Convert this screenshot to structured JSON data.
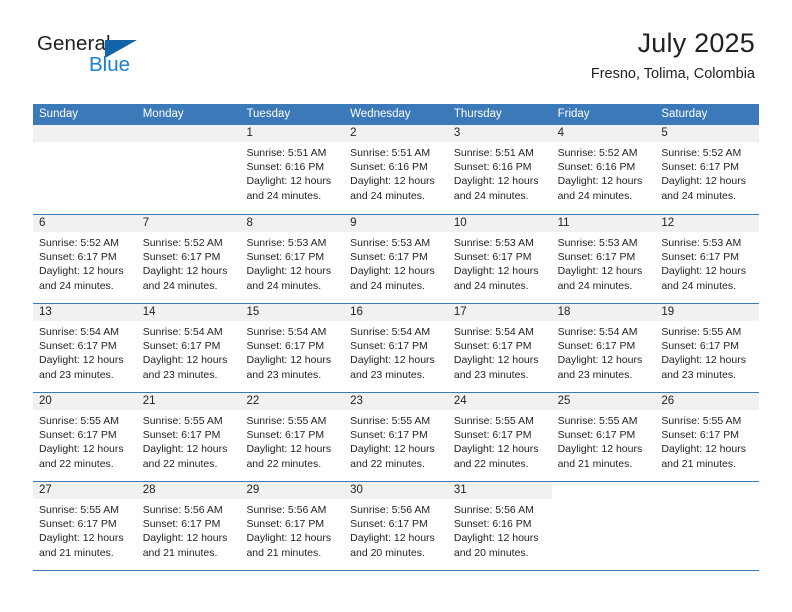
{
  "brand": {
    "name_part1": "General",
    "name_part2": "Blue",
    "logo_icon": "triangle-logo-icon"
  },
  "header": {
    "title": "July 2025",
    "location": "Fresno, Tolima, Colombia"
  },
  "calendar": {
    "weekday_headers": [
      "Sunday",
      "Monday",
      "Tuesday",
      "Wednesday",
      "Thursday",
      "Friday",
      "Saturday"
    ],
    "accent_color": "#3b79b8",
    "daynum_strip_color": "#f1f1f1",
    "weeks": [
      [
        {
          "day": "",
          "blank": true
        },
        {
          "day": "",
          "blank": true
        },
        {
          "day": "1",
          "sunrise": "Sunrise: 5:51 AM",
          "sunset": "Sunset: 6:16 PM",
          "daylight1": "Daylight: 12 hours",
          "daylight2": "and 24 minutes."
        },
        {
          "day": "2",
          "sunrise": "Sunrise: 5:51 AM",
          "sunset": "Sunset: 6:16 PM",
          "daylight1": "Daylight: 12 hours",
          "daylight2": "and 24 minutes."
        },
        {
          "day": "3",
          "sunrise": "Sunrise: 5:51 AM",
          "sunset": "Sunset: 6:16 PM",
          "daylight1": "Daylight: 12 hours",
          "daylight2": "and 24 minutes."
        },
        {
          "day": "4",
          "sunrise": "Sunrise: 5:52 AM",
          "sunset": "Sunset: 6:16 PM",
          "daylight1": "Daylight: 12 hours",
          "daylight2": "and 24 minutes."
        },
        {
          "day": "5",
          "sunrise": "Sunrise: 5:52 AM",
          "sunset": "Sunset: 6:17 PM",
          "daylight1": "Daylight: 12 hours",
          "daylight2": "and 24 minutes."
        }
      ],
      [
        {
          "day": "6",
          "sunrise": "Sunrise: 5:52 AM",
          "sunset": "Sunset: 6:17 PM",
          "daylight1": "Daylight: 12 hours",
          "daylight2": "and 24 minutes."
        },
        {
          "day": "7",
          "sunrise": "Sunrise: 5:52 AM",
          "sunset": "Sunset: 6:17 PM",
          "daylight1": "Daylight: 12 hours",
          "daylight2": "and 24 minutes."
        },
        {
          "day": "8",
          "sunrise": "Sunrise: 5:53 AM",
          "sunset": "Sunset: 6:17 PM",
          "daylight1": "Daylight: 12 hours",
          "daylight2": "and 24 minutes."
        },
        {
          "day": "9",
          "sunrise": "Sunrise: 5:53 AM",
          "sunset": "Sunset: 6:17 PM",
          "daylight1": "Daylight: 12 hours",
          "daylight2": "and 24 minutes."
        },
        {
          "day": "10",
          "sunrise": "Sunrise: 5:53 AM",
          "sunset": "Sunset: 6:17 PM",
          "daylight1": "Daylight: 12 hours",
          "daylight2": "and 24 minutes."
        },
        {
          "day": "11",
          "sunrise": "Sunrise: 5:53 AM",
          "sunset": "Sunset: 6:17 PM",
          "daylight1": "Daylight: 12 hours",
          "daylight2": "and 24 minutes."
        },
        {
          "day": "12",
          "sunrise": "Sunrise: 5:53 AM",
          "sunset": "Sunset: 6:17 PM",
          "daylight1": "Daylight: 12 hours",
          "daylight2": "and 24 minutes."
        }
      ],
      [
        {
          "day": "13",
          "sunrise": "Sunrise: 5:54 AM",
          "sunset": "Sunset: 6:17 PM",
          "daylight1": "Daylight: 12 hours",
          "daylight2": "and 23 minutes."
        },
        {
          "day": "14",
          "sunrise": "Sunrise: 5:54 AM",
          "sunset": "Sunset: 6:17 PM",
          "daylight1": "Daylight: 12 hours",
          "daylight2": "and 23 minutes."
        },
        {
          "day": "15",
          "sunrise": "Sunrise: 5:54 AM",
          "sunset": "Sunset: 6:17 PM",
          "daylight1": "Daylight: 12 hours",
          "daylight2": "and 23 minutes."
        },
        {
          "day": "16",
          "sunrise": "Sunrise: 5:54 AM",
          "sunset": "Sunset: 6:17 PM",
          "daylight1": "Daylight: 12 hours",
          "daylight2": "and 23 minutes."
        },
        {
          "day": "17",
          "sunrise": "Sunrise: 5:54 AM",
          "sunset": "Sunset: 6:17 PM",
          "daylight1": "Daylight: 12 hours",
          "daylight2": "and 23 minutes."
        },
        {
          "day": "18",
          "sunrise": "Sunrise: 5:54 AM",
          "sunset": "Sunset: 6:17 PM",
          "daylight1": "Daylight: 12 hours",
          "daylight2": "and 23 minutes."
        },
        {
          "day": "19",
          "sunrise": "Sunrise: 5:55 AM",
          "sunset": "Sunset: 6:17 PM",
          "daylight1": "Daylight: 12 hours",
          "daylight2": "and 23 minutes."
        }
      ],
      [
        {
          "day": "20",
          "sunrise": "Sunrise: 5:55 AM",
          "sunset": "Sunset: 6:17 PM",
          "daylight1": "Daylight: 12 hours",
          "daylight2": "and 22 minutes."
        },
        {
          "day": "21",
          "sunrise": "Sunrise: 5:55 AM",
          "sunset": "Sunset: 6:17 PM",
          "daylight1": "Daylight: 12 hours",
          "daylight2": "and 22 minutes."
        },
        {
          "day": "22",
          "sunrise": "Sunrise: 5:55 AM",
          "sunset": "Sunset: 6:17 PM",
          "daylight1": "Daylight: 12 hours",
          "daylight2": "and 22 minutes."
        },
        {
          "day": "23",
          "sunrise": "Sunrise: 5:55 AM",
          "sunset": "Sunset: 6:17 PM",
          "daylight1": "Daylight: 12 hours",
          "daylight2": "and 22 minutes."
        },
        {
          "day": "24",
          "sunrise": "Sunrise: 5:55 AM",
          "sunset": "Sunset: 6:17 PM",
          "daylight1": "Daylight: 12 hours",
          "daylight2": "and 22 minutes."
        },
        {
          "day": "25",
          "sunrise": "Sunrise: 5:55 AM",
          "sunset": "Sunset: 6:17 PM",
          "daylight1": "Daylight: 12 hours",
          "daylight2": "and 21 minutes."
        },
        {
          "day": "26",
          "sunrise": "Sunrise: 5:55 AM",
          "sunset": "Sunset: 6:17 PM",
          "daylight1": "Daylight: 12 hours",
          "daylight2": "and 21 minutes."
        }
      ],
      [
        {
          "day": "27",
          "sunrise": "Sunrise: 5:55 AM",
          "sunset": "Sunset: 6:17 PM",
          "daylight1": "Daylight: 12 hours",
          "daylight2": "and 21 minutes."
        },
        {
          "day": "28",
          "sunrise": "Sunrise: 5:56 AM",
          "sunset": "Sunset: 6:17 PM",
          "daylight1": "Daylight: 12 hours",
          "daylight2": "and 21 minutes."
        },
        {
          "day": "29",
          "sunrise": "Sunrise: 5:56 AM",
          "sunset": "Sunset: 6:17 PM",
          "daylight1": "Daylight: 12 hours",
          "daylight2": "and 21 minutes."
        },
        {
          "day": "30",
          "sunrise": "Sunrise: 5:56 AM",
          "sunset": "Sunset: 6:17 PM",
          "daylight1": "Daylight: 12 hours",
          "daylight2": "and 20 minutes."
        },
        {
          "day": "31",
          "sunrise": "Sunrise: 5:56 AM",
          "sunset": "Sunset: 6:16 PM",
          "daylight1": "Daylight: 12 hours",
          "daylight2": "and 20 minutes."
        },
        {
          "day": "",
          "blank": true,
          "empty": true
        },
        {
          "day": "",
          "blank": true,
          "empty": true
        }
      ]
    ]
  }
}
